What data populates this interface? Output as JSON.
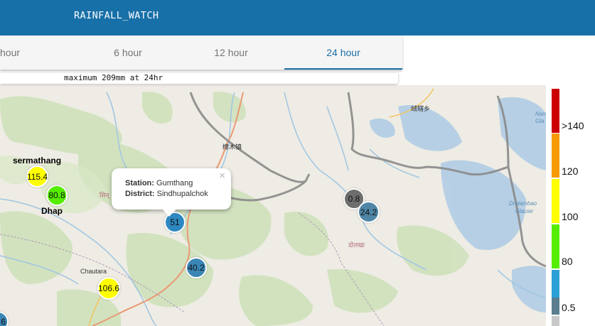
{
  "header": {
    "title": "RAINFALL_WATCH",
    "bg_color": "#1870a8"
  },
  "tabs": [
    {
      "label": "hour",
      "active": false
    },
    {
      "label": "6 hour",
      "active": false
    },
    {
      "label": "12 hour",
      "active": false
    },
    {
      "label": "24 hour",
      "active": true
    }
  ],
  "info": {
    "text": "maximum 209mm at 24hr"
  },
  "legend": {
    "bins": [
      {
        "label": ">140",
        "color": "#cc0000"
      },
      {
        "label": "120",
        "color": "#f59b00"
      },
      {
        "label": "100",
        "color": "#ffff00"
      },
      {
        "label": "80",
        "color": "#55ee00"
      },
      {
        "label": "0.5",
        "color": "#2b9fd8"
      }
    ],
    "extra_colors": [
      "#5a7d90",
      "#c8c8c8"
    ]
  },
  "stations": [
    {
      "value": "115.4",
      "color": "#ffff00"
    },
    {
      "value": "80.8",
      "color": "#55ee00"
    },
    {
      "value": "51",
      "color": "#2e88c0"
    },
    {
      "value": "40.2",
      "color": "#3a86b5"
    },
    {
      "value": "106.6",
      "color": "#ffff00"
    },
    {
      "value": "0.8",
      "color": "#6e6e6e"
    },
    {
      "value": "24.2",
      "color": "#4f86a6"
    },
    {
      "value": "6",
      "color": "#3a86b5"
    }
  ],
  "places": {
    "sermathang": "sermathang",
    "dhap": "Dhap"
  },
  "map_labels": {
    "chautara": "Chautara",
    "zhangmu": "樟木镇",
    "rongxia": "绒辖乡",
    "dolakha": "दोलखा",
    "sindhu": "सिन्",
    "drolambao": "Drolambao",
    "glacier": "Glacier",
    "nan": "Nan",
    "gla": "Gla"
  },
  "popup": {
    "station_label": "Station:",
    "station_value": "Gumthang",
    "district_label": "District:",
    "district_value": "Sindhupalchok",
    "close_symbol": "×"
  }
}
